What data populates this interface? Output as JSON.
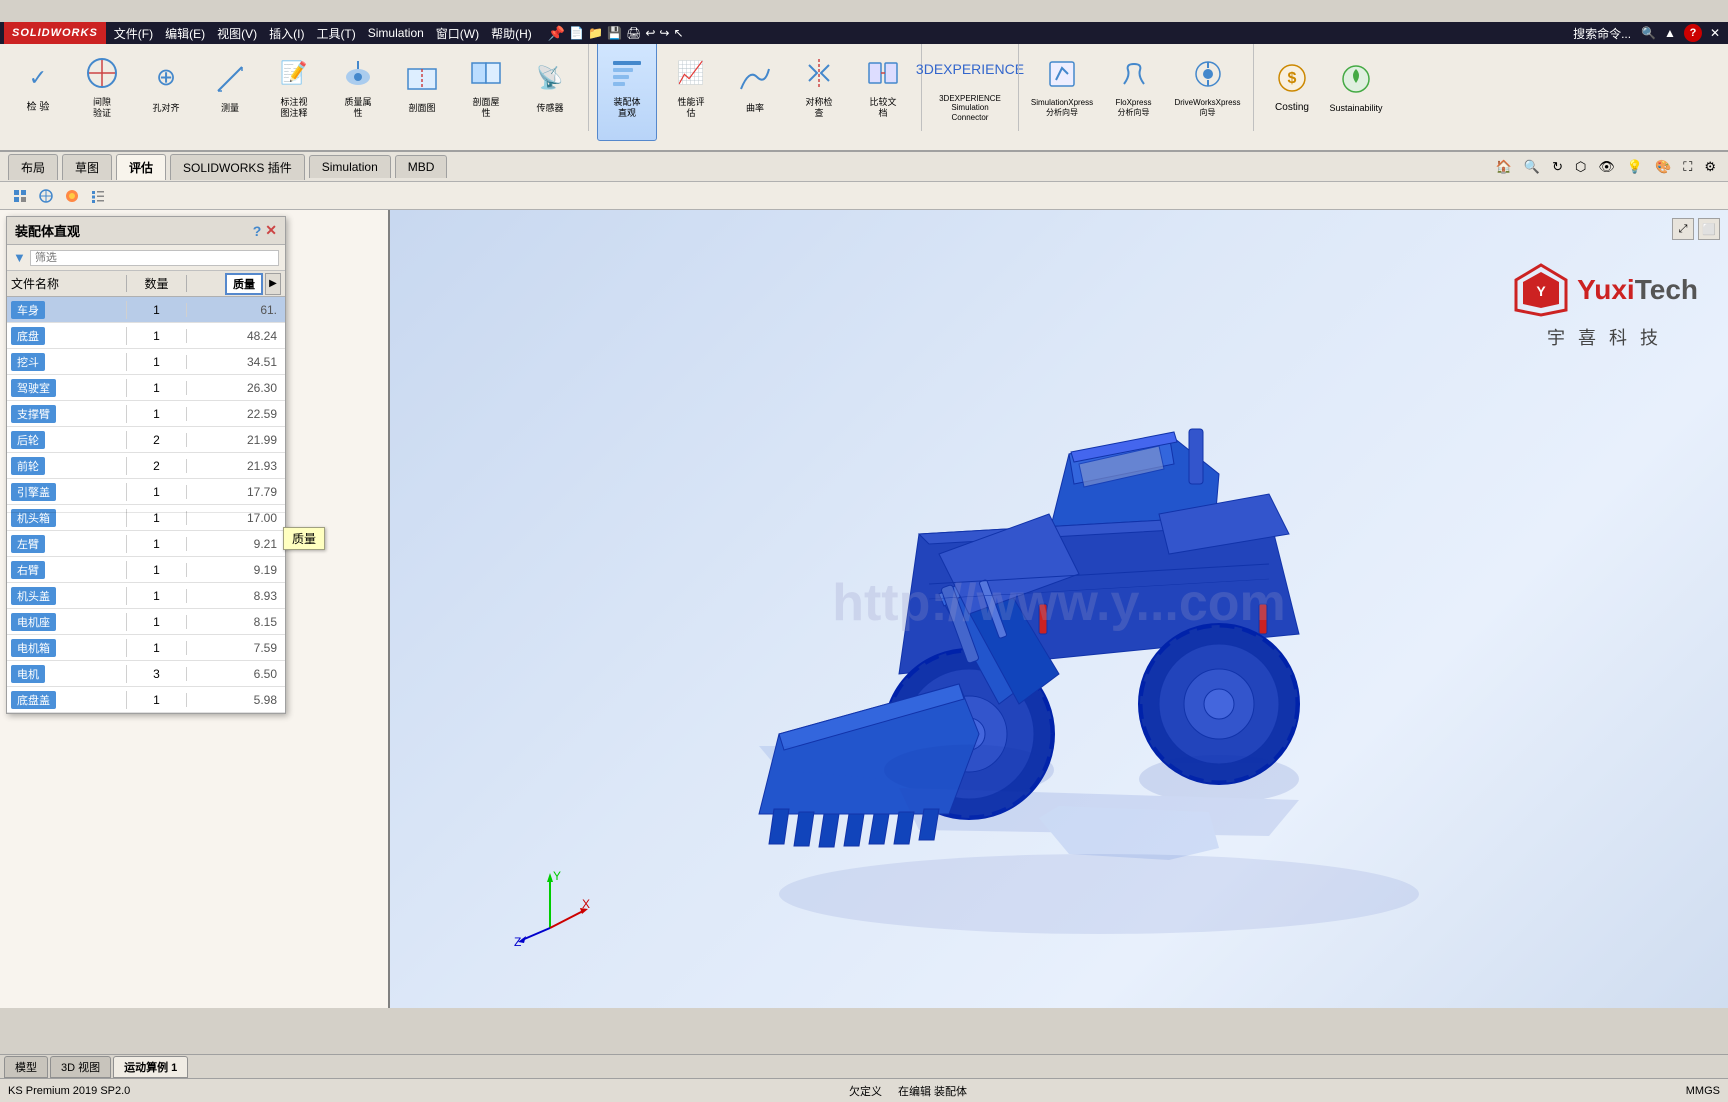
{
  "app": {
    "title": "SOLIDWORKS Premium 2019 SP2.0",
    "logo_text": "SOLIDWORKS"
  },
  "quick_access": {
    "menu_items": [
      "文件(F)",
      "编辑(E)",
      "视图(V)",
      "插入(I)",
      "工具(T)",
      "Simulation",
      "窗口(W)",
      "帮助(H)"
    ]
  },
  "ribbon": {
    "active_tab": "装配体直观",
    "tools": [
      {
        "id": "check1",
        "label": "检\n验",
        "icon": "✓"
      },
      {
        "id": "check2",
        "label": "间隙\n验证",
        "icon": "⬡"
      },
      {
        "id": "hole-align",
        "label": "孔对齐",
        "icon": "⊕"
      },
      {
        "id": "measure",
        "label": "测量",
        "icon": "📐"
      },
      {
        "id": "note",
        "label": "标注视\n图注释",
        "icon": "📝"
      },
      {
        "id": "mass-props",
        "label": "质量属\n性",
        "icon": "⚖"
      },
      {
        "id": "section",
        "label": "剖面图",
        "icon": "▣"
      },
      {
        "id": "section2",
        "label": "剖面屋\n性",
        "icon": "◫"
      },
      {
        "id": "sensor",
        "label": "传感器",
        "icon": "📡"
      },
      {
        "id": "assembly-view",
        "label": "装配体\n直观",
        "icon": "📊",
        "active": true
      },
      {
        "id": "perf-eval",
        "label": "性能评\n估",
        "icon": "📈"
      },
      {
        "id": "curve",
        "label": "曲率",
        "icon": "〰"
      },
      {
        "id": "symmetry",
        "label": "对称检\n查",
        "icon": "⇔"
      },
      {
        "id": "compare-doc",
        "label": "比较文\n档",
        "icon": "⟺"
      },
      {
        "id": "3dexp",
        "label": "3DEXPERIENCE\nSimulation\nConnector",
        "icon": "🌐"
      },
      {
        "id": "sim-xpress",
        "label": "SimulationXpress\n分析向导",
        "icon": "🔬"
      },
      {
        "id": "flo-xpress",
        "label": "FloXpress\n分析向导",
        "icon": "💧"
      },
      {
        "id": "driveworks",
        "label": "DriveWorksXpress\n向导",
        "icon": "⚙"
      },
      {
        "id": "costing",
        "label": "Costing",
        "icon": "💲"
      },
      {
        "id": "sustainability",
        "label": "Sustainability",
        "icon": "🌱"
      }
    ]
  },
  "sub_tabs": {
    "tabs": [
      "布局",
      "草图",
      "评估",
      "SOLIDWORKS 插件",
      "Simulation",
      "MBD"
    ],
    "active": "评估"
  },
  "second_toolbar": {
    "tools": [
      "⊞",
      "⊕",
      "⊙",
      "🎨",
      "⊟"
    ]
  },
  "assembly_panel": {
    "title": "装配体直观",
    "filter_placeholder": "筛选",
    "columns": {
      "name": "文件名称",
      "qty": "数量",
      "mass": "质量"
    },
    "rows": [
      {
        "name": "车身",
        "qty": "1",
        "mass": "61.",
        "selected": true
      },
      {
        "name": "底盘",
        "qty": "1",
        "mass": "48.24",
        "selected": false
      },
      {
        "name": "挖斗",
        "qty": "1",
        "mass": "34.51",
        "selected": false
      },
      {
        "name": "驾驶室",
        "qty": "1",
        "mass": "26.30",
        "selected": false
      },
      {
        "name": "支撑臂",
        "qty": "1",
        "mass": "22.59",
        "selected": false
      },
      {
        "name": "后轮",
        "qty": "2",
        "mass": "21.99",
        "selected": false
      },
      {
        "name": "前轮",
        "qty": "2",
        "mass": "21.93",
        "selected": false
      },
      {
        "name": "引擎盖",
        "qty": "1",
        "mass": "17.79",
        "selected": false
      },
      {
        "name": "机头箱",
        "qty": "1",
        "mass": "17.00",
        "selected": false
      },
      {
        "name": "左臂",
        "qty": "1",
        "mass": "9.21",
        "selected": false
      },
      {
        "name": "右臂",
        "qty": "1",
        "mass": "9.19",
        "selected": false
      },
      {
        "name": "机头盖",
        "qty": "1",
        "mass": "8.93",
        "selected": false
      },
      {
        "name": "电机座",
        "qty": "1",
        "mass": "8.15",
        "selected": false
      },
      {
        "name": "电机箱",
        "qty": "1",
        "mass": "7.59",
        "selected": false
      },
      {
        "name": "电机",
        "qty": "3",
        "mass": "6.50",
        "selected": false
      },
      {
        "name": "底盘盖",
        "qty": "1",
        "mass": "5.98",
        "selected": false
      }
    ],
    "tooltip": "质量"
  },
  "bottom_tabs": {
    "tabs": [
      "模型",
      "3D 视图",
      "运动算例 1"
    ],
    "active": "运动算例 1"
  },
  "status_bar": {
    "left": "KS Premium 2019 SP2.0",
    "center_items": [
      "欠定义",
      "在编辑 装配体"
    ],
    "right": "MMGS"
  },
  "view_toolbar": {
    "buttons": [
      "🔍",
      "🔎",
      "👁",
      "📐",
      "🔦",
      "⬡",
      "💡",
      "🎨"
    ]
  },
  "viewport": {
    "watermark": "http://www.y...com"
  },
  "logo": {
    "yuxi": "Yuxi",
    "tech": "Tech",
    "subtitle": "宇 喜 科 技"
  }
}
